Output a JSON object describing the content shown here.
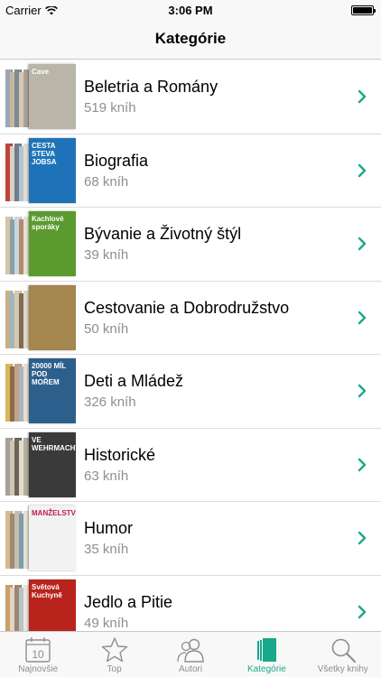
{
  "status_bar": {
    "carrier": "Carrier",
    "time": "3:06 PM",
    "battery_level": 1.0
  },
  "nav": {
    "title": "Kategórie"
  },
  "categories": [
    {
      "title": "Beletria a Romány",
      "count": "519 kníh",
      "cover_color": "#b9b5a8",
      "cover_text": "Cave"
    },
    {
      "title": "Biografia",
      "count": "68 kníh",
      "cover_color": "#1e73b8",
      "cover_text": "CESTA STEVA JOBSA"
    },
    {
      "title": "Bývanie a Životný štýl",
      "count": "39 kníh",
      "cover_color": "#5a9a2e",
      "cover_text": "Kachlové sporáky"
    },
    {
      "title": "Cestovanie a Dobrodružstvo",
      "count": "50 kníh",
      "cover_color": "#a5864e",
      "cover_text": ""
    },
    {
      "title": "Deti a Mládež",
      "count": "326 kníh",
      "cover_color": "#2d5f8c",
      "cover_text": "20000 MÍL POD MOŘEM"
    },
    {
      "title": "Historické",
      "count": "63 kníh",
      "cover_color": "#3a3a3a",
      "cover_text": "VE WEHRMACHTU"
    },
    {
      "title": "Humor",
      "count": "35 kníh",
      "cover_color": "#f2f2f2",
      "cover_text": "MANŽELSTVÍ:"
    },
    {
      "title": "Jedlo a Pitie",
      "count": "49 kníh",
      "cover_color": "#b8231c",
      "cover_text": "Světová Kuchyně"
    }
  ],
  "tabs": [
    {
      "label": "Najnovšie",
      "icon": "calendar-icon",
      "badge": "10",
      "active": false
    },
    {
      "label": "Top",
      "icon": "star-icon",
      "active": false
    },
    {
      "label": "Autori",
      "icon": "people-icon",
      "active": false
    },
    {
      "label": "Kategórie",
      "icon": "books-icon",
      "active": true
    },
    {
      "label": "Všetky knihy",
      "icon": "search-icon",
      "active": false
    }
  ],
  "colors": {
    "accent": "#19a88c",
    "inactive": "#8e8e93",
    "chevron": "#19a88c"
  }
}
